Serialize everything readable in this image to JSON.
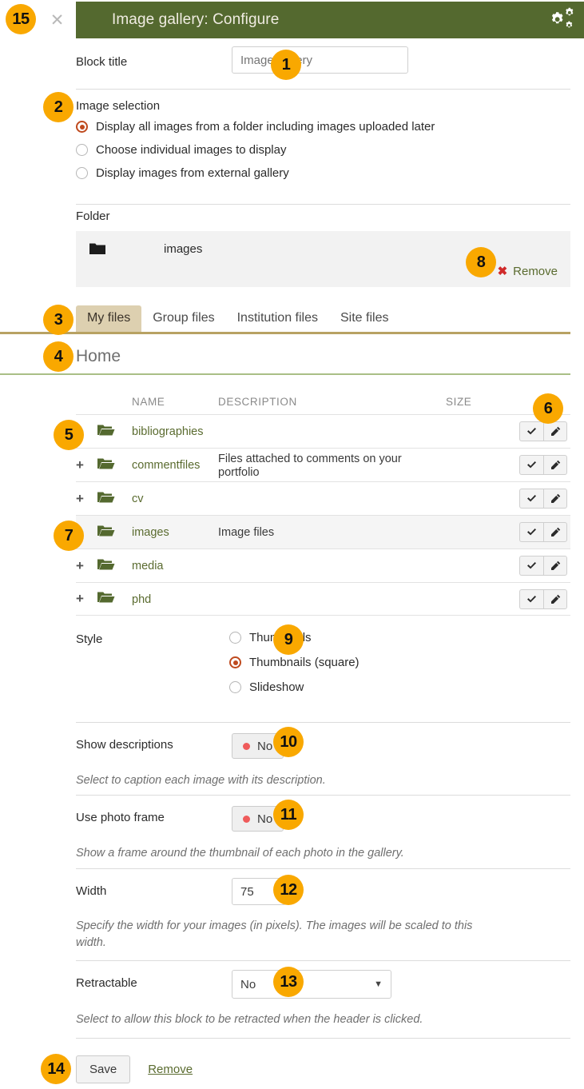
{
  "header": {
    "title": "Image gallery: Configure",
    "close_icon": "close-icon",
    "settings_icon": "gears-icon",
    "bg_color": "#54692f"
  },
  "block_title": {
    "label": "Block title",
    "value": "Image gallery",
    "placeholder": "Image gallery"
  },
  "image_selection": {
    "label": "Image selection",
    "options": [
      {
        "label": "Display all images from a folder including images uploaded later",
        "selected": true
      },
      {
        "label": "Choose individual images to display",
        "selected": false
      },
      {
        "label": "Display images from external gallery",
        "selected": false
      }
    ]
  },
  "folder": {
    "label": "Folder",
    "icon": "folder-icon",
    "name": "images",
    "remove_label": "Remove",
    "remove_icon": "x-mark-icon"
  },
  "file_tabs": [
    {
      "label": "My files",
      "active": true
    },
    {
      "label": "Group files",
      "active": false
    },
    {
      "label": "Institution files",
      "active": false
    },
    {
      "label": "Site files",
      "active": false
    }
  ],
  "breadcrumb": "Home",
  "file_table": {
    "columns": [
      "NAME",
      "DESCRIPTION",
      "SIZE"
    ],
    "rows": [
      {
        "name": "bibliographies",
        "description": "",
        "size": "",
        "highlighted": false
      },
      {
        "name": "commentfiles",
        "description": "Files attached to comments on your portfolio",
        "size": "",
        "highlighted": false
      },
      {
        "name": "cv",
        "description": "",
        "size": "",
        "highlighted": false
      },
      {
        "name": "images",
        "description": "Image files",
        "size": "",
        "highlighted": true
      },
      {
        "name": "media",
        "description": "",
        "size": "",
        "highlighted": false
      },
      {
        "name": "phd",
        "description": "",
        "size": "",
        "highlighted": false
      }
    ],
    "expand_icon": "plus-icon",
    "folder_icon": "folder-open-icon",
    "select_icon": "check-icon",
    "edit_icon": "pencil-icon"
  },
  "style": {
    "label": "Style",
    "options": [
      {
        "label": "Thumbnails",
        "selected": false
      },
      {
        "label": "Thumbnails (square)",
        "selected": true
      },
      {
        "label": "Slideshow",
        "selected": false
      }
    ]
  },
  "show_descriptions": {
    "label": "Show descriptions",
    "value": "No",
    "help": "Select to caption each image with its description."
  },
  "use_photo_frame": {
    "label": "Use photo frame",
    "value": "No",
    "help": "Show a frame around the thumbnail of each photo in the gallery."
  },
  "width": {
    "label": "Width",
    "value": "75",
    "help": "Specify the width for your images (in pixels). The images will be scaled to this width."
  },
  "retractable": {
    "label": "Retractable",
    "value": "No",
    "help": "Select to allow this block to be retracted when the header is clicked."
  },
  "footer": {
    "save_label": "Save",
    "remove_label": "Remove"
  },
  "badges": {
    "b1": "1",
    "b2": "2",
    "b3": "3",
    "b4": "4",
    "b5": "5",
    "b6": "6",
    "b7": "7",
    "b8": "8",
    "b9": "9",
    "b10": "10",
    "b11": "11",
    "b12": "12",
    "b13": "13",
    "b14": "14",
    "b15": "15"
  },
  "colors": {
    "header_green": "#54692f",
    "badge_orange": "#f9a800",
    "tab_active": "#ddd0b0",
    "tab_underline": "#b8a263",
    "crumb_underline": "#a9bf86",
    "link_green": "#5a6b2f",
    "radio_selected": "#bf4a1e",
    "toggle_dot_red": "#ef5b5b",
    "remove_x_red": "#d02a2a"
  }
}
